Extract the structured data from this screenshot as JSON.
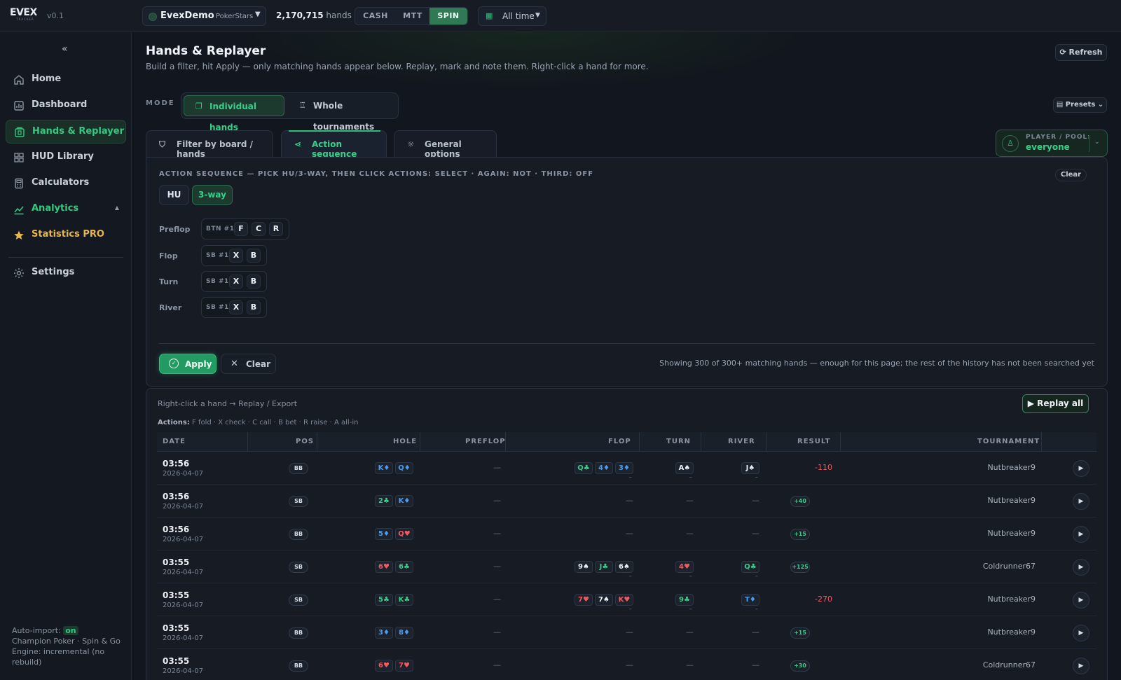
{
  "app": {
    "version": "v0.1",
    "logo_text": "EVEX",
    "logo_sub": "TRACKER"
  },
  "topbar": {
    "account_name": "EvexDemo",
    "account_site": "PokerStars",
    "hand_count": "2,170,715",
    "hand_count_label": "hands",
    "game_types": [
      "CASH",
      "MTT",
      "SPIN"
    ],
    "active_game_type": "SPIN",
    "time_filter": "All time"
  },
  "sidebar": {
    "collapse_label": "«",
    "items": [
      {
        "label": "Home",
        "icon": "home-icon"
      },
      {
        "label": "Dashboard",
        "icon": "dashboard-icon"
      },
      {
        "label": "Hands & Replayer",
        "icon": "hands-icon",
        "active": true
      },
      {
        "label": "HUD Library",
        "icon": "hud-icon"
      },
      {
        "label": "Calculators",
        "icon": "calculator-icon"
      },
      {
        "label": "Analytics",
        "icon": "analytics-icon",
        "expanded": true
      },
      {
        "label": "Statistics PRO",
        "icon": "star-icon"
      },
      {
        "label": "Settings",
        "icon": "gear-icon"
      }
    ],
    "analytics_arrow": "▲",
    "footer": {
      "auto_import_label": "Auto-import:",
      "auto_import_status": "on",
      "room_line": "Champion Poker · Spin & Go",
      "engine_line": "Engine: incremental (no rebuild)"
    }
  },
  "page": {
    "title": "Hands & Replayer",
    "subtitle": "Build a filter, hit Apply — only matching hands appear below. Replay, mark and note them. Right-click a hand for more.",
    "refresh_label": "⟳ Refresh",
    "mode_label": "MODE",
    "modes": [
      "Individual hands",
      "Whole tournaments"
    ],
    "active_mode": "Individual hands",
    "presets_label": "▤ Presets ⌄",
    "tabs": [
      "Filter by board / hands",
      "Action sequence",
      "General options"
    ],
    "active_tab": "Action sequence",
    "player_pool_label": "PLAYER / POOL:",
    "player_pool_value": "everyone"
  },
  "action_sequence": {
    "title": "ACTION SEQUENCE — PICK HU/3-WAY, THEN CLICK ACTIONS: SELECT · AGAIN: NOT · THIRD: OFF",
    "clear_label": "Clear",
    "ways": [
      "HU",
      "3-way"
    ],
    "active_way": "3-way",
    "streets": [
      {
        "name": "Preflop",
        "actor": "BTN #1",
        "actions": [
          "F",
          "C",
          "R"
        ]
      },
      {
        "name": "Flop",
        "actor": "SB #1",
        "actions": [
          "X",
          "B"
        ]
      },
      {
        "name": "Turn",
        "actor": "SB #1",
        "actions": [
          "X",
          "B"
        ]
      },
      {
        "name": "River",
        "actor": "SB #1",
        "actions": [
          "X",
          "B"
        ]
      }
    ],
    "apply_label": "Apply",
    "clear_button_label": "Clear",
    "showing_text": "Showing 300 of 300+ matching hands — enough for this page; the rest of the history has not been searched yet"
  },
  "hands_table": {
    "hint": "Right-click a hand → Replay / Export",
    "replay_all_label": "▶ Replay all",
    "legend_label": "Actions:",
    "legend_text": "F fold · X check · C call · B bet · R raise · A all-in",
    "columns": [
      "DATE",
      "POS",
      "HOLE",
      "PREFLOP",
      "FLOP",
      "TURN",
      "RIVER",
      "RESULT",
      "TOURNAMENT"
    ],
    "empty_mark": "—",
    "sub_mark": "–",
    "rows": [
      {
        "time": "03:56",
        "date": "2026-04-07",
        "pos": "BB",
        "hole": [
          [
            "K♦",
            "d"
          ],
          [
            "Q♦",
            "d"
          ]
        ],
        "flop": [
          [
            "Q♣",
            "c"
          ],
          [
            "4♦",
            "d"
          ],
          [
            "3♦",
            "d"
          ]
        ],
        "turn": [
          [
            "A♠",
            "s"
          ]
        ],
        "river": [
          [
            "J♠",
            "s"
          ]
        ],
        "result": "-110",
        "tournament": "Nutbreaker9"
      },
      {
        "time": "03:56",
        "date": "2026-04-07",
        "pos": "SB",
        "hole": [
          [
            "2♣",
            "c"
          ],
          [
            "K♦",
            "d"
          ]
        ],
        "flop": [],
        "turn": [],
        "river": [],
        "result": "+40",
        "tournament": "Nutbreaker9"
      },
      {
        "time": "03:56",
        "date": "2026-04-07",
        "pos": "BB",
        "hole": [
          [
            "5♦",
            "d"
          ],
          [
            "Q♥",
            "h"
          ]
        ],
        "flop": [],
        "turn": [],
        "river": [],
        "result": "+15",
        "tournament": "Nutbreaker9"
      },
      {
        "time": "03:55",
        "date": "2026-04-07",
        "pos": "SB",
        "hole": [
          [
            "6♥",
            "h"
          ],
          [
            "6♣",
            "c"
          ]
        ],
        "flop": [
          [
            "9♠",
            "s"
          ],
          [
            "J♣",
            "c"
          ],
          [
            "6♠",
            "s"
          ]
        ],
        "turn": [
          [
            "4♥",
            "h"
          ]
        ],
        "river": [
          [
            "Q♣",
            "c"
          ]
        ],
        "result": "+125",
        "tournament": "Coldrunner67"
      },
      {
        "time": "03:55",
        "date": "2026-04-07",
        "pos": "SB",
        "hole": [
          [
            "5♣",
            "c"
          ],
          [
            "K♣",
            "c"
          ]
        ],
        "flop": [
          [
            "7♥",
            "h"
          ],
          [
            "7♠",
            "s"
          ],
          [
            "K♥",
            "h"
          ]
        ],
        "turn": [
          [
            "9♣",
            "c"
          ]
        ],
        "river": [
          [
            "T♦",
            "d"
          ]
        ],
        "result": "-270",
        "tournament": "Nutbreaker9"
      },
      {
        "time": "03:55",
        "date": "2026-04-07",
        "pos": "BB",
        "hole": [
          [
            "3♦",
            "d"
          ],
          [
            "8♦",
            "d"
          ]
        ],
        "flop": [],
        "turn": [],
        "river": [],
        "result": "+15",
        "tournament": "Nutbreaker9"
      },
      {
        "time": "03:55",
        "date": "2026-04-07",
        "pos": "BB",
        "hole": [
          [
            "6♥",
            "h"
          ],
          [
            "7♥",
            "h"
          ]
        ],
        "flop": [],
        "turn": [],
        "river": [],
        "result": "+30",
        "tournament": "Coldrunner67"
      }
    ]
  },
  "colors": {
    "accent": "#2fbf7a",
    "gold": "#e7b74b",
    "negative": "#ef5a63",
    "diamond": "#4a9cf0"
  }
}
